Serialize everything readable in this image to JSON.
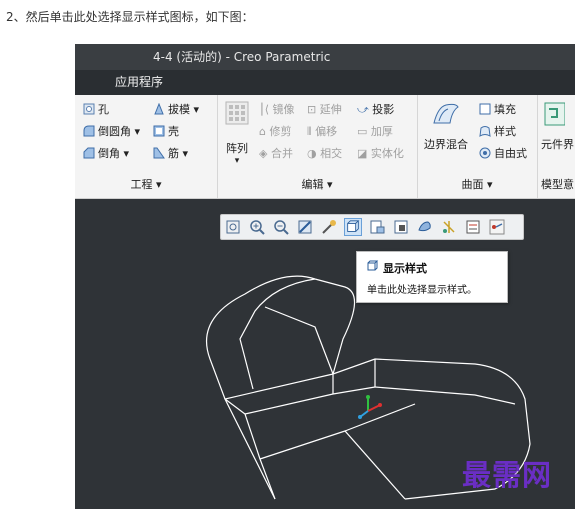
{
  "caption": "2、然后单击此处选择显示样式图标，如下图：",
  "window": {
    "title": "4-4 (活动的) - Creo Parametric"
  },
  "menubar": {
    "app_menu": "应用程序"
  },
  "ribbon": {
    "engineering": {
      "hole": "孔",
      "draft": "拔模",
      "round": "倒圆角",
      "shell": "壳",
      "chamfer": "倒角",
      "rib": "筋",
      "group": "工程"
    },
    "edit": {
      "pattern": "阵列",
      "mirror": "镜像",
      "extend": "延伸",
      "project": "投影",
      "trim": "修剪",
      "offset": "偏移",
      "thicken": "加厚",
      "merge": "合并",
      "intersect": "相交",
      "solidify": "实体化",
      "group": "编辑"
    },
    "surface": {
      "boundary_blend": "边界混合",
      "fill": "填充",
      "style": "样式",
      "freestyle": "自由式",
      "group": "曲面"
    },
    "model_intent": {
      "component": "元件界",
      "group": "模型意"
    }
  },
  "view_toolbar": {
    "icons": [
      "zoom-fit-icon",
      "zoom-in-icon",
      "zoom-out-icon",
      "repaint-icon",
      "reorient-icon",
      "display-style-icon",
      "named-views-icon",
      "saved-orientations-icon",
      "view-manager-icon",
      "datum-display-icon",
      "spin-center-icon",
      "annotation-icon"
    ],
    "active": "display-style-icon"
  },
  "tooltip": {
    "title": "显示样式",
    "description": "单击此处选择显示样式。"
  },
  "watermark": "最需网",
  "colors": {
    "viewport_bg": "#2f3337",
    "ribbon_bg": "#f4f4f4",
    "titlebar_bg": "#3a3e42",
    "watermark": "#6a2ec4",
    "triad_x": "#e03030",
    "triad_y": "#30c040",
    "triad_z": "#30a0e0"
  }
}
